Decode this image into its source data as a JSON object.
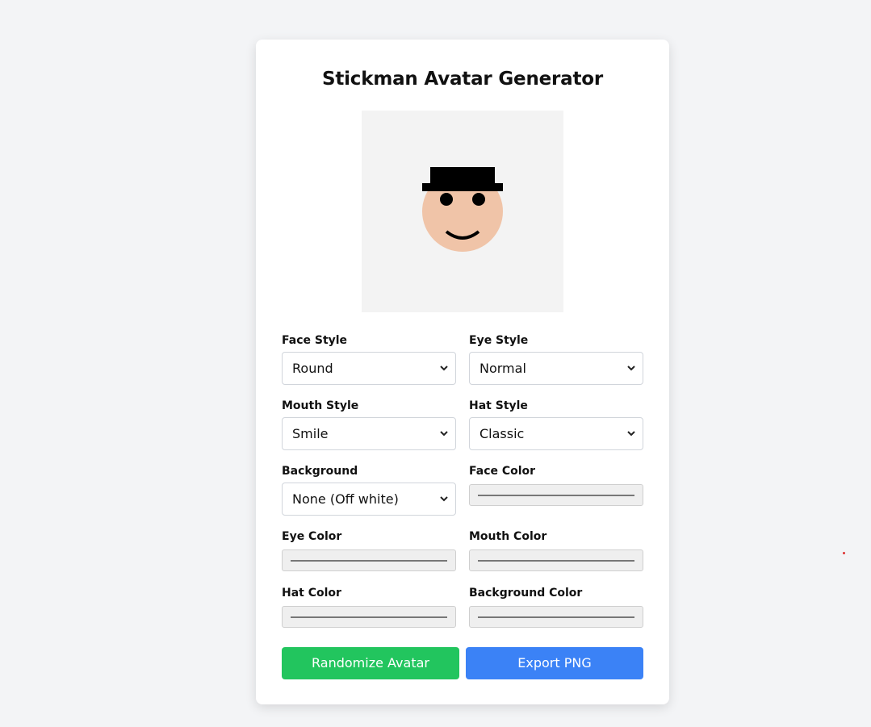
{
  "title": "Stickman Avatar Generator",
  "avatar": {
    "background_color": "#f3f3f3",
    "face_color": "#f0c4a8",
    "eye_color": "#000000",
    "mouth_color": "#000000",
    "hat_color": "#000000"
  },
  "fields": {
    "face_style": {
      "label": "Face Style",
      "value": "Round"
    },
    "eye_style": {
      "label": "Eye Style",
      "value": "Normal"
    },
    "mouth_style": {
      "label": "Mouth Style",
      "value": "Smile"
    },
    "hat_style": {
      "label": "Hat Style",
      "value": "Classic"
    },
    "background": {
      "label": "Background",
      "value": "None (Off white)"
    },
    "face_color": {
      "label": "Face Color"
    },
    "eye_color": {
      "label": "Eye Color"
    },
    "mouth_color": {
      "label": "Mouth Color"
    },
    "hat_color": {
      "label": "Hat Color"
    },
    "background_color": {
      "label": "Background Color"
    }
  },
  "buttons": {
    "randomize": "Randomize Avatar",
    "export": "Export PNG"
  },
  "colors": {
    "randomize_button": "#22c55e",
    "export_button": "#3b82f6",
    "page_background": "#f3f4f6"
  }
}
